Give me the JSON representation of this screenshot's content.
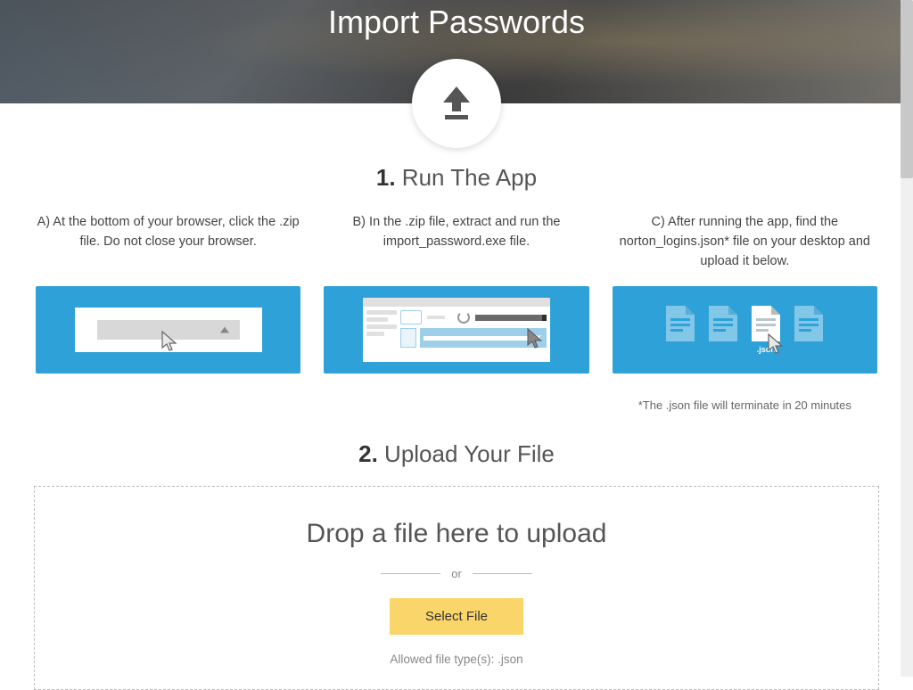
{
  "hero": {
    "title": "Import Passwords"
  },
  "step1": {
    "num": "1.",
    "label": "Run The App",
    "columns": [
      {
        "text": "A) At the bottom of your browser, click the .zip file. Do not close your browser."
      },
      {
        "text": "B) In the .zip file, extract and run the import_password.exe file."
      },
      {
        "text": "C) After running the app, find the norton_logins.json* file on your desktop and upload it below."
      }
    ],
    "json_label": ".json",
    "footnote": "*The .json file will terminate in 20 minutes"
  },
  "step2": {
    "num": "2.",
    "label": "Upload Your File",
    "drop_title": "Drop a file here to upload",
    "or": "or",
    "select_label": "Select File",
    "allowed": "Allowed file type(s): .json"
  }
}
